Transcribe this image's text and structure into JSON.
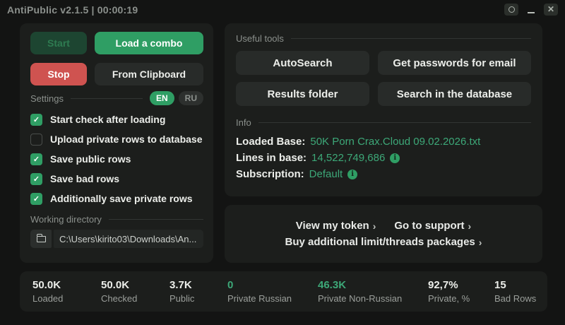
{
  "titlebar": {
    "title": "AntiPublic v2.1.5 | 00:00:19"
  },
  "left_panel": {
    "buttons": {
      "start": "Start",
      "load_combo": "Load a combo",
      "stop": "Stop",
      "from_clipboard": "From Clipboard"
    },
    "settings": {
      "section_label": "Settings",
      "languages": [
        {
          "label": "EN",
          "active": true
        },
        {
          "label": "RU",
          "active": false
        }
      ],
      "checkboxes": [
        {
          "label": "Start check after loading",
          "checked": true
        },
        {
          "label": "Upload private rows to database",
          "checked": false
        },
        {
          "label": "Save public rows",
          "checked": true
        },
        {
          "label": "Save bad rows",
          "checked": true
        },
        {
          "label": "Additionally save private rows",
          "checked": true
        }
      ]
    },
    "working_directory": {
      "section_label": "Working directory",
      "path": "C:\\Users\\kirito03\\Downloads\\An..."
    }
  },
  "tools": {
    "section_label": "Useful tools",
    "autosearch": "AutoSearch",
    "get_passwords": "Get passwords for email",
    "results_folder": "Results folder",
    "search_database": "Search in the database"
  },
  "info": {
    "section_label": "Info",
    "loaded_base": {
      "label": "Loaded Base:",
      "value": "50K Porn Crax.Cloud 09.02.2026.txt"
    },
    "lines_in_base": {
      "label": "Lines in base:",
      "value": "14,522,749,686"
    },
    "subscription": {
      "label": "Subscription:",
      "value": "Default"
    },
    "info_icon_glyph": "i"
  },
  "links": {
    "view_token": "View my token",
    "support": "Go to support",
    "buy_packages": "Buy additional limit/threads packages",
    "chevron": "›"
  },
  "stats": {
    "items": [
      {
        "value": "50.0K",
        "label": "Loaded",
        "accent": false
      },
      {
        "value": "50.0K",
        "label": "Checked",
        "accent": false
      },
      {
        "value": "3.7K",
        "label": "Public",
        "accent": false
      },
      {
        "value": "0",
        "label": "Private Russian",
        "accent": true
      },
      {
        "value": "46.3K",
        "label": "Private Non-Russian",
        "accent": true
      },
      {
        "value": "92,7%",
        "label": "Private, %",
        "accent": false
      },
      {
        "value": "15",
        "label": "Bad Rows",
        "accent": false
      }
    ]
  },
  "colors": {
    "accent_green": "#2f9e64",
    "value_green": "#3da878",
    "danger_red": "#cf5350"
  }
}
